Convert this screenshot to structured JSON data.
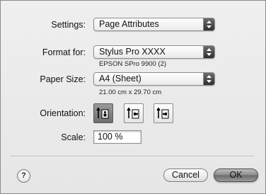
{
  "settings": {
    "label": "Settings:",
    "value": "Page Attributes"
  },
  "format_for": {
    "label": "Format for:",
    "value": "Stylus Pro XXXX",
    "printer_name": "EPSON SPro 9900 (2)"
  },
  "paper_size": {
    "label": "Paper Size:",
    "value": "A4 (Sheet)",
    "dimensions": "21.00 cm x 29.70 cm"
  },
  "orientation": {
    "label": "Orientation:",
    "options": [
      "portrait",
      "landscape",
      "landscape-reversed"
    ],
    "selected": "portrait"
  },
  "scale": {
    "label": "Scale:",
    "value": "100 %"
  },
  "buttons": {
    "help": "?",
    "cancel": "Cancel",
    "ok": "OK"
  }
}
